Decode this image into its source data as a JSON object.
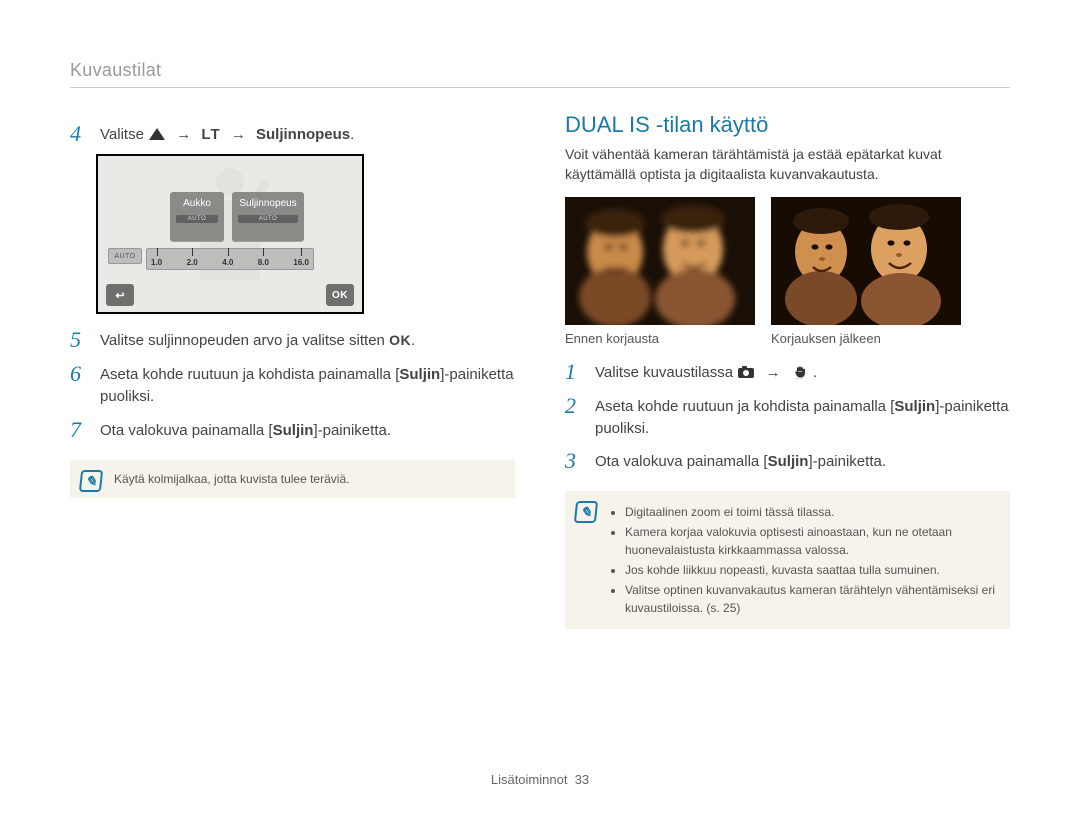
{
  "breadcrumb": "Kuvaustilat",
  "left": {
    "step4": {
      "num": "4",
      "pre": "Valitse ",
      "arrow": "→",
      "lt": "LT",
      "post_bold": "Suljinnopeus",
      "post_after": "."
    },
    "camera": {
      "aperture_label": "Aukko",
      "shutter_label": "Suljinnopeus",
      "auto_chip": "AUTO",
      "scale": [
        "1.0",
        "2.0",
        "4.0",
        "8.0",
        "16.0"
      ],
      "back": "↩",
      "ok": "OK"
    },
    "step5": {
      "num": "5",
      "text_pre": "Valitse suljinnopeuden arvo ja valitse sitten ",
      "ok": "OK",
      "text_post": "."
    },
    "step6": {
      "num": "6",
      "text_pre": "Aseta kohde ruutuun ja kohdista painamalla [",
      "bold": "Suljin",
      "text_mid": "]-painiketta puoliksi."
    },
    "step7": {
      "num": "7",
      "text_pre": "Ota valokuva painamalla [",
      "bold": "Suljin",
      "text_post": "]-painiketta."
    },
    "note": "Käytä kolmijalkaa, jotta kuvista tulee teräviä."
  },
  "right": {
    "title": "DUAL IS -tilan käyttö",
    "lead": "Voit vähentää kameran tärähtämistä ja estää epätarkat kuvat käyttämällä optista ja digitaalista kuvanvakautusta.",
    "caption_before": "Ennen korjausta",
    "caption_after": "Korjauksen jälkeen",
    "step1": {
      "num": "1",
      "text": "Valitse kuvaustilassa ",
      "arrow": "→",
      "post": "."
    },
    "step2": {
      "num": "2",
      "text_pre": "Aseta kohde ruutuun ja kohdista painamalla [",
      "bold": "Suljin",
      "text_post": "]-painiketta puoliksi."
    },
    "step3": {
      "num": "3",
      "text_pre": "Ota valokuva painamalla [",
      "bold": "Suljin",
      "text_post": "]-painiketta."
    },
    "notes": [
      "Digitaalinen zoom ei toimi tässä tilassa.",
      "Kamera korjaa valokuvia optisesti ainoastaan, kun ne otetaan huonevalaistusta kirkkaammassa valossa.",
      "Jos kohde liikkuu nopeasti, kuvasta saattaa tulla sumuinen.",
      "Valitse optinen kuvanvakautus kameran tärähtelyn vähentämiseksi eri kuvaustiloissa. (s. 25)"
    ]
  },
  "footer": {
    "label": "Lisätoiminnot",
    "page": "33"
  }
}
